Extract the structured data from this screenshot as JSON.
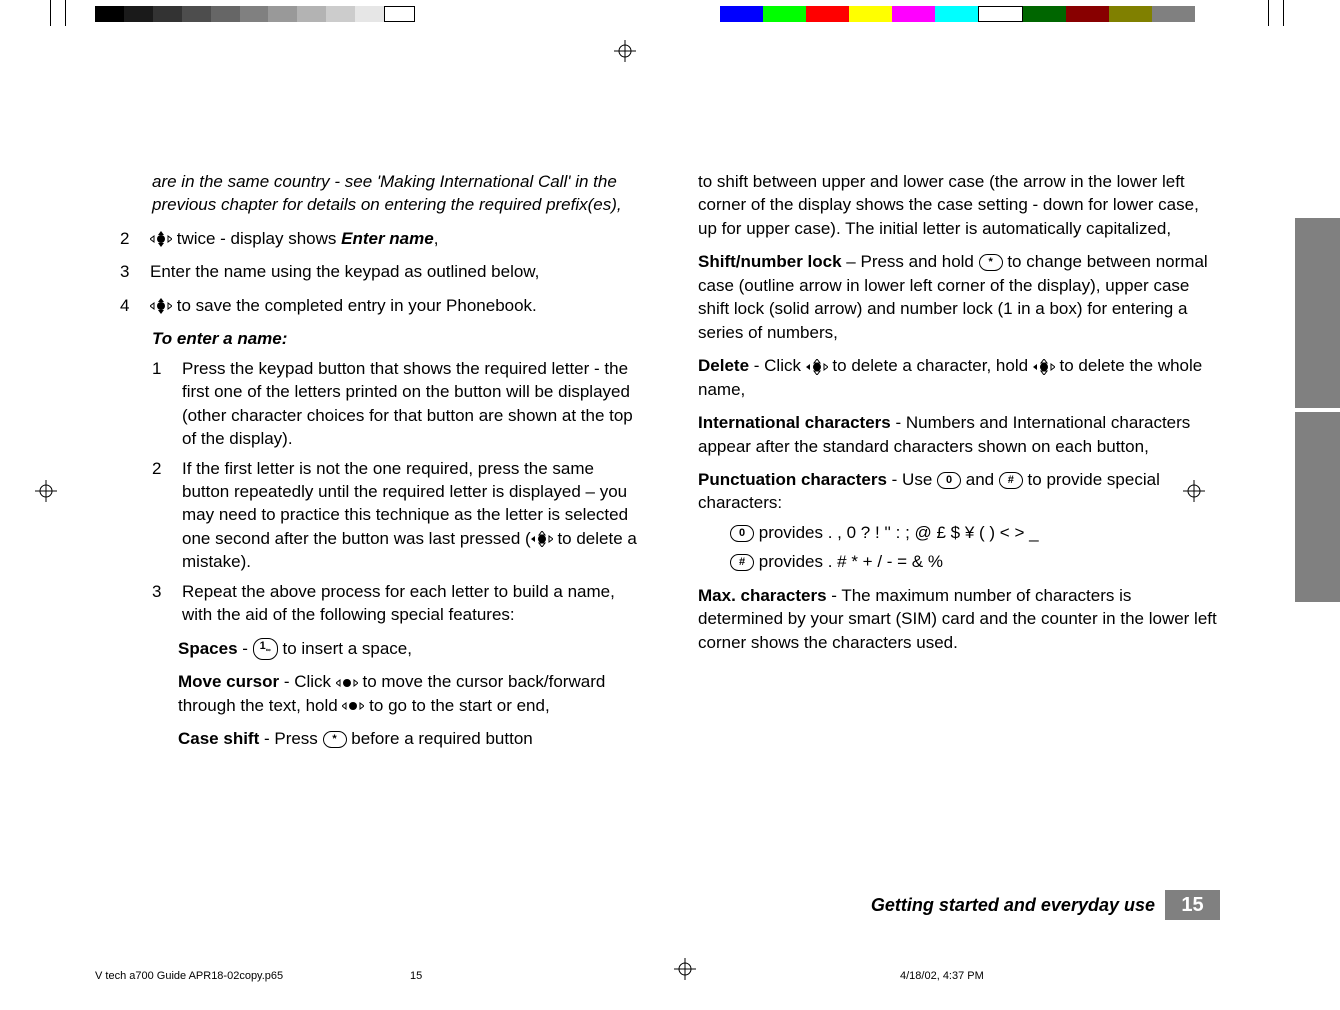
{
  "left": {
    "intro_italic": "are in the same country - see 'Making International Call' in the previous chapter for details on entering the required prefix(es),",
    "step2_a": " twice - display shows ",
    "step2_b": "Enter name",
    "step2_c": ",",
    "step3": "Enter the name using the keypad as outlined below,",
    "step4": " to save the completed entry in your Phonebook.",
    "enter_name_heading": "To enter a name:",
    "en1": "Press the keypad button that shows the required letter - the first one of the letters printed on the button will be displayed (other character choices for that button are shown at the top of the display).",
    "en2_a": "If the first letter is not the one required, press the same button repeatedly until the required letter is displayed – you may need to practice this technique as the letter is selected one second after the button was last pressed (",
    "en2_b": " to delete a mistake).",
    "en3": "Repeat the above process for each letter to build a name, with the aid of the following special features:",
    "spaces_label": "Spaces",
    "spaces_rest": " to insert a space,",
    "spaces_sep": " - ",
    "move_label": "Move cursor",
    "move_a": " - Click ",
    "move_b": " to move the cursor back/forward through the text, hold ",
    "move_c": " to go to the start or end,",
    "case_label": "Case shift",
    "case_a": " - Press ",
    "case_b": " before a required button"
  },
  "right": {
    "case_cont": "to shift between upper and lower case (the arrow in the lower left corner of the display shows the case setting - down for lower case, up for upper case). The initial letter is automatically capitalized,",
    "shift_label": "Shift/number lock",
    "shift_a": " – Press and hold ",
    "shift_b": " to change between normal case (outline arrow in lower left corner of the display), upper case shift lock (solid arrow) and number lock (1 in a box) for entering a series of numbers,",
    "del_label": "Delete",
    "del_a": " - Click ",
    "del_b": " to delete a character, hold ",
    "del_c": " to delete the whole name,",
    "intl_label": "International characters",
    "intl_rest": " - Numbers and International characters appear after the standard characters shown on each button,",
    "punct_label": "Punctuation characters",
    "punct_a": " - Use ",
    "punct_b": " and ",
    "punct_c": " to provide special characters:",
    "row0_chars": "provides . , 0 ? ! '' : ; @ £ $ ¥ ( ) < > _",
    "rowhash_chars": "provides . # * + / - = & %",
    "max_label": "Max. characters",
    "max_rest": " - The maximum number of characters is determined by your smart (SIM) card and the counter in the lower left corner shows the characters used."
  },
  "keys": {
    "one": "1",
    "zero": "0",
    "hash": "#",
    "star": "*"
  },
  "footer": {
    "section": "Getting started and everyday use",
    "page": "15"
  },
  "prepress": {
    "file": "V tech a700 Guide APR18-02copy.p65",
    "page": "15",
    "date": "4/18/02, 4:37 PM"
  }
}
